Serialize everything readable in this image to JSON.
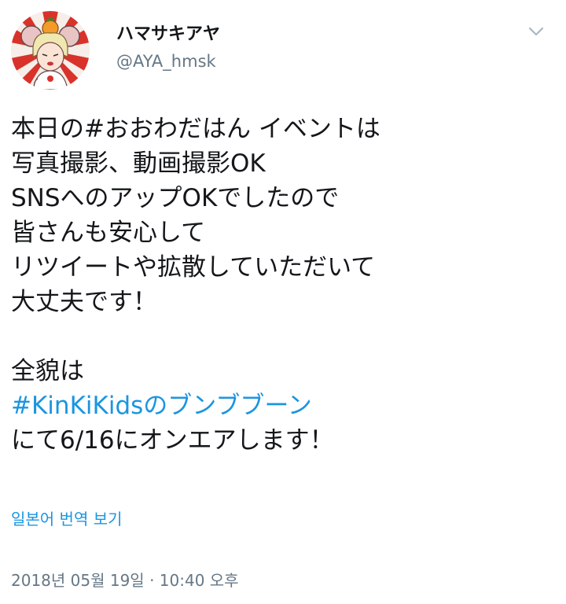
{
  "user": {
    "display_name": "ハマサキアヤ",
    "handle": "@AYA_hmsk",
    "avatar_icon": "avatar-illustration-icon"
  },
  "menu": {
    "icon": "chevron-down-icon",
    "color": "#aab8c2"
  },
  "tweet": {
    "lines": [
      "本日の#おおわだはん イベントは",
      "写真撮影、動画撮影OK",
      "SNSへのアップOKでしたので",
      "皆さんも安心して",
      "リツイートや拡散していただいて",
      "大丈夫です！",
      "全貌は"
    ],
    "hashtag": "#KinKiKidsのブンブブーン",
    "last_line": "にて6/16にオンエアします！"
  },
  "translate": {
    "label": "일본어 번역 보기"
  },
  "timestamp": {
    "text": "2018년 05월 19일 · 10:40 오후"
  },
  "colors": {
    "text": "#14171a",
    "secondary": "#657786",
    "link": "#1b95e0"
  }
}
